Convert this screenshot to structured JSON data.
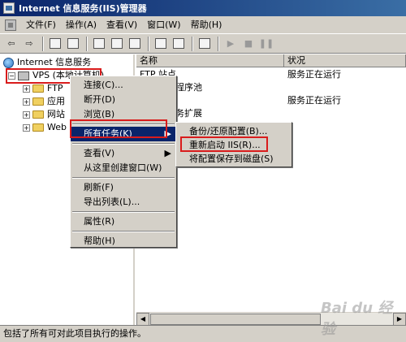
{
  "window": {
    "title": "Internet 信息服务(IIS)管理器"
  },
  "menu": [
    "文件(F)",
    "操作(A)",
    "查看(V)",
    "窗口(W)",
    "帮助(H)"
  ],
  "tree": {
    "root": "Internet 信息服务",
    "server": "VPS (本地计算机)",
    "children": [
      "FTP",
      "应用",
      "网站",
      "Web"
    ]
  },
  "list": {
    "columns": {
      "name": "名称",
      "status": "状况"
    },
    "rows": [
      {
        "name": "FTP 站点",
        "status": "服务正在运行"
      },
      {
        "name": "程序池",
        "status": ""
      },
      {
        "name": "",
        "status": "服务正在运行"
      },
      {
        "name": "务扩展",
        "status": ""
      }
    ]
  },
  "context_menu": {
    "items": [
      "连接(C)...",
      "断开(D)",
      "浏览(B)",
      "所有任务(K)",
      "查看(V)",
      "从这里创建窗口(W)",
      "刷新(F)",
      "导出列表(L)...",
      "属性(R)",
      "帮助(H)"
    ]
  },
  "submenu": {
    "items": [
      "备份/还原配置(B)...",
      "重新启动 IIS(R)...",
      "将配置保存到磁盘(S)"
    ]
  },
  "status_text": "包括了所有可对此项目执行的操作。",
  "watermark": "Bai du 经验"
}
